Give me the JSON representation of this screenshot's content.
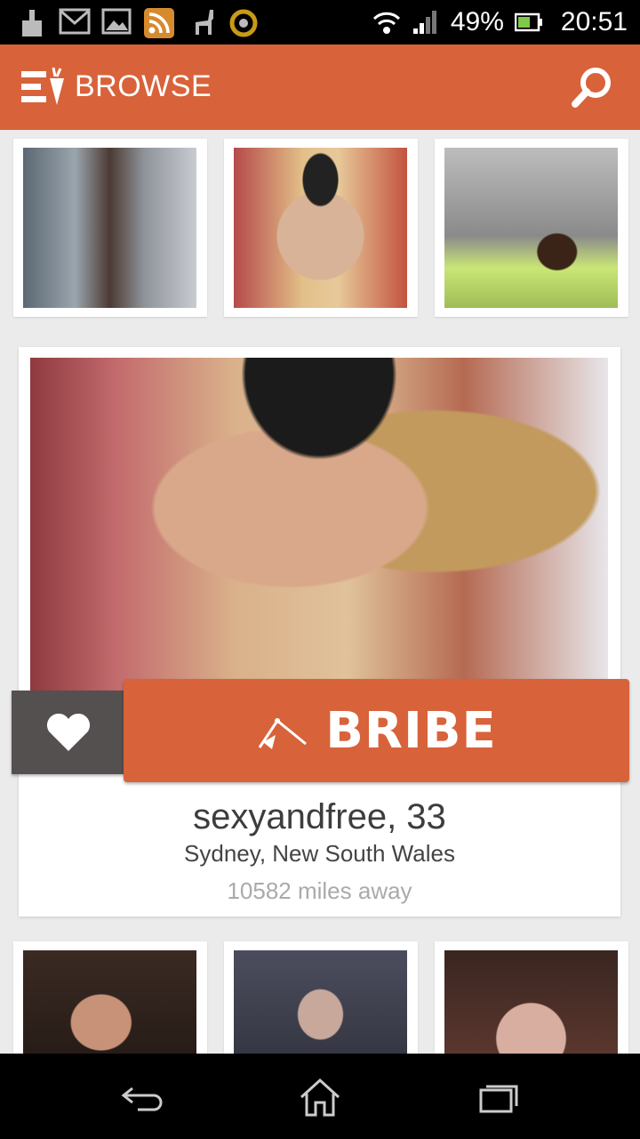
{
  "status_bar": {
    "battery": "49%",
    "time": "20:51"
  },
  "app_bar": {
    "title": "BROWSE",
    "menu_icon": "menu-carrot-logo-icon",
    "search_icon": "search-icon"
  },
  "featured": {
    "username_age": "sexyandfree, 33",
    "location": "Sydney, New South Wales",
    "distance": "10582 miles away",
    "bribe_label": "BRIBE",
    "fav_icon": "heart-icon"
  },
  "colors": {
    "accent": "#d8623a",
    "fav_bg": "#555050"
  }
}
